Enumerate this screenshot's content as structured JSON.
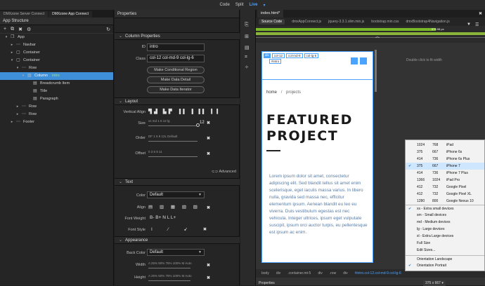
{
  "topbar": {
    "code": "Code",
    "split": "Split",
    "live": "Live"
  },
  "left": {
    "tabs": [
      "DMXzone Server Connect",
      "DMXzone App Connect"
    ],
    "title": "App Structure",
    "tree": [
      {
        "label": "App",
        "extra": ""
      },
      {
        "label": "Navbar",
        "extra": ""
      },
      {
        "label": "Container",
        "extra": ""
      },
      {
        "label": "Container",
        "extra": ""
      },
      {
        "label": "Row",
        "extra": ""
      },
      {
        "label": "Column",
        "extra": "intro"
      },
      {
        "label": "Breadcrumb Item",
        "extra": ""
      },
      {
        "label": "Title",
        "extra": ""
      },
      {
        "label": "Paragraph",
        "extra": ""
      },
      {
        "label": "Row",
        "extra": ""
      },
      {
        "label": "Row",
        "extra": ""
      },
      {
        "label": "Footer",
        "extra": ""
      }
    ]
  },
  "props": {
    "title": "Properties",
    "column_section": "Column Properties",
    "id_label": "ID",
    "id_value": "intro",
    "class_label": "Class",
    "class_value": "col-12 col-md-9 col-lg-6",
    "btn_region": "Make Conditional Region",
    "btn_detail": "Make Data Detail",
    "btn_iterator": "Make Data Iterator",
    "layout_section": "Layout",
    "valign_label": "Vertical Align",
    "size_label": "Size",
    "size_ticks": "xs md  1      6       12 lg",
    "size_value": "12",
    "order_label": "Order",
    "order_ticks": "DF 1    5    9    12L  Default",
    "offset_label": "Offset",
    "offset_ticks": "0     3     6     9    11",
    "advanced": "Advanced",
    "text_section": "Text",
    "color_label": "Color",
    "color_value": "Default",
    "align_label": "Align",
    "fontweight_label": "Font Weight",
    "fontweight_opts": "B-  B+   N    L    L+",
    "fontstyle_label": "Font Style",
    "appearance_section": "Appearance",
    "backcolor_label": "Back Color",
    "backcolor_value": "Default",
    "width_label": "Width",
    "width_opts": "A  25% 50% 75% 100%  M  Auto",
    "height_label": "Height",
    "height_opts": "A  25% 50% 75% 100%  M  Auto"
  },
  "doc": {
    "tab": "index.html*",
    "related": [
      "Source Code",
      "dmxAppConnect.js",
      "jquery-3.3.1.slim.min.js",
      "bootstrap.min.css",
      "dmxBootstrap4Navigation.js"
    ],
    "ruler_label": "575.98 px",
    "dblclick": "Double click to fit width",
    "breadcrumb_home": "home",
    "breadcrumb_sep": "/",
    "breadcrumb_page": "projects",
    "heading_1": "FEATURED",
    "heading_2": "PROJECT",
    "body_text": "Lorem ipsum dolor sit amet, consectetur adipiscing elit. Sed blandit tellus sit amet enim scelerisque, eget iaculis massa varius. In libero nulla, gravida sed massa nec, efficitur elementum ipsum. Aenean blandit eu leo eu viverra. Duis vestibulum egestas est nec vehicula. Integer ultrices, ipsum eget vulputate suscipit, ipsum orci auctor turpis, eu pellentesque est ipsum ac enim.",
    "badges": [
      "div",
      "col-12",
      "col-md-9",
      "col-lg-6"
    ],
    "badge_id": "#intro",
    "status": [
      "body",
      "div",
      ".container.mt-5",
      "div",
      ".row",
      "div",
      "#intro.col-12.col-md-9.col-lg-6"
    ],
    "status_size": "375 x 667",
    "bottom": "Properties"
  },
  "devices": [
    {
      "a": "1024",
      "b": "768",
      "c": "iPad",
      "checked": false
    },
    {
      "a": "375",
      "b": "667",
      "c": "iPhone 6s",
      "checked": false
    },
    {
      "a": "414",
      "b": "736",
      "c": "iPhone 6s Plus",
      "checked": false
    },
    {
      "a": "375",
      "b": "667",
      "c": "iPhone 7",
      "checked": true
    },
    {
      "a": "414",
      "b": "736",
      "c": "iPhone 7 Plus",
      "checked": false
    },
    {
      "a": "1366",
      "b": "1024",
      "c": "iPad Pro",
      "checked": false
    },
    {
      "a": "412",
      "b": "732",
      "c": "Google Pixel",
      "checked": false
    },
    {
      "a": "412",
      "b": "732",
      "c": "Google Pixel XL",
      "checked": false
    },
    {
      "a": "1280",
      "b": "800",
      "c": "Google Nexus 10",
      "checked": false
    }
  ],
  "breakpoints": [
    {
      "label": "xs - Extra small devices",
      "checked": true
    },
    {
      "label": "sm - Small devices",
      "checked": false
    },
    {
      "label": "md - Medium devices",
      "checked": false
    },
    {
      "label": "lg - Large devices",
      "checked": false
    },
    {
      "label": "xl - Extra Large devices",
      "checked": false
    },
    {
      "label": "Full Size",
      "checked": false
    },
    {
      "label": "Edit Sizes...",
      "checked": false
    }
  ],
  "orientation": [
    {
      "label": "Orientation Landscape",
      "checked": false
    },
    {
      "label": "Orientation Portrait",
      "checked": true
    }
  ]
}
